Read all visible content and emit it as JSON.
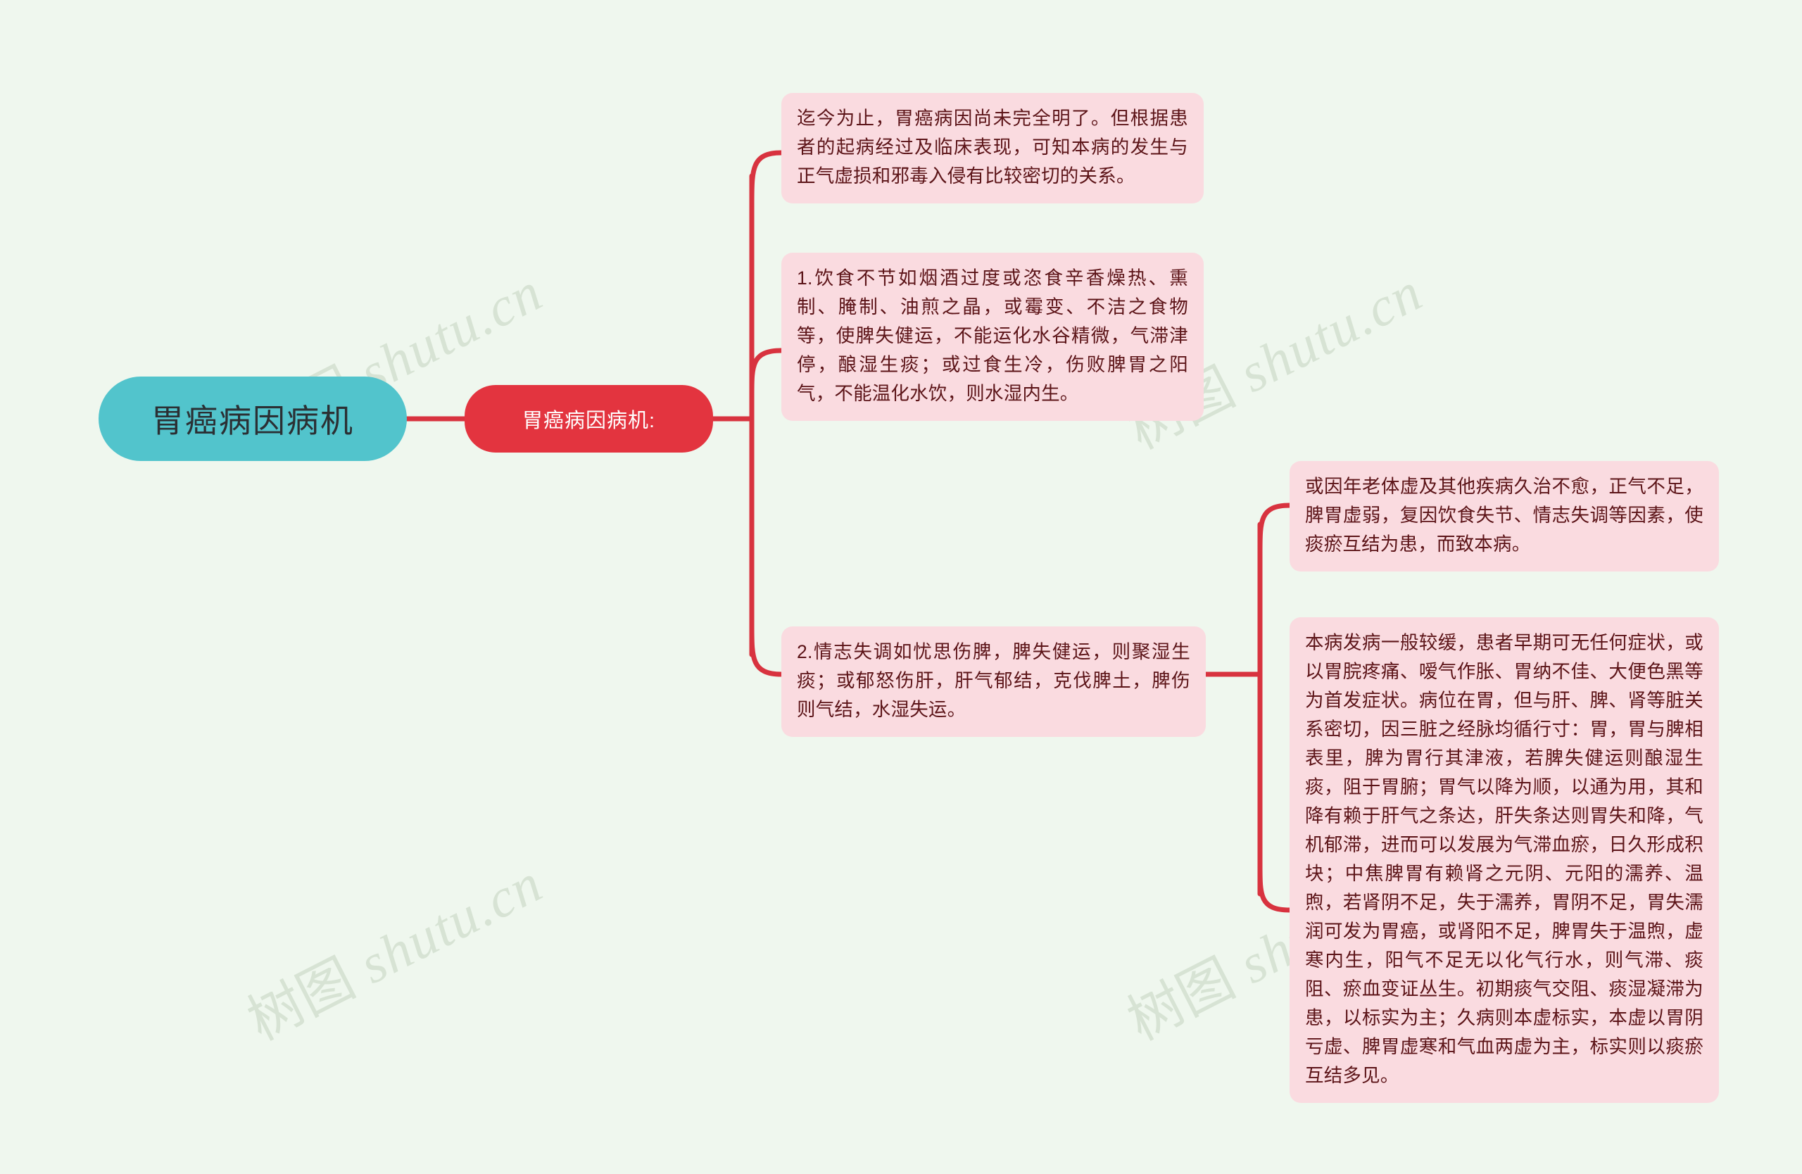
{
  "diagram": {
    "type": "mindmap",
    "orientation": "left-to-right",
    "background_color": "#eff7ee",
    "title": "胃癌病因病机"
  },
  "watermark": {
    "text": "树图 shutu.cn",
    "cjk": "树图",
    "latin": " shutu.cn",
    "color": "#d7e3d4"
  },
  "root": {
    "label": "胃癌病因病机",
    "fill": "#52c4cc",
    "text_color": "#2b3034"
  },
  "branch": {
    "label": "胃癌病因病机:",
    "fill": "#e3343f",
    "text_color": "#ffffff"
  },
  "link_color": "#d8333f",
  "leaf_fill": "#fadbe0",
  "leaf_text_color": "#5c1418",
  "leaves": {
    "etiology_overview": "迄今为止，胃癌病因尚未完全明了。但根据患者的起病经过及临床表现，可知本病的发生与正气虚损和邪毒入侵有比较密切的关系。",
    "cause_1_diet": "1.饮食不节如烟酒过度或恣食辛香燥热、熏制、腌制、油煎之晶，或霉变、不洁之食物等，使脾失健运，不能运化水谷精微，气滞津停，酿湿生痰；或过食生冷，伤败脾胃之阳气，不能温化水饮，则水湿内生。",
    "cause_2_emotion": "2.情志失调如忧思伤脾，脾失健运，则聚湿生痰；或郁怒伤肝，肝气郁结，克伐脾土，脾伤则气结，水湿失运。",
    "deficiency": "或因年老体虚及其他疾病久治不愈，正气不足，脾胃虚弱，复因饮食失节、情志失调等因素，使痰瘀互结为患，而致本病。",
    "pathogenesis": "本病发病一般较缓，患者早期可无任何症状，或以胃脘疼痛、嗳气作胀、胃纳不佳、大便色黑等为首发症状。病位在胃，但与肝、脾、肾等脏关系密切，因三脏之经脉均循行寸：胃，胃与脾相表里，脾为胃行其津液，若脾失健运则酿湿生痰，阻于胃腑；胃气以降为顺，以通为用，其和降有赖于肝气之条达，肝失条达则胃失和降，气机郁滞，进而可以发展为气滞血瘀，日久形成积块；中焦脾胃有赖肾之元阴、元阳的濡养、温煦，若肾阴不足，失于濡养，胃阴不足，胃失濡润可发为胃癌，或肾阳不足，脾胃失于温煦，虚寒内生，阳气不足无以化气行水，则气滞、痰阻、瘀血变证丛生。初期痰气交阻、痰湿凝滞为患，以标实为主；久病则本虚标实，本虚以胃阴亏虚、脾胃虚寒和气血两虚为主，标实则以痰瘀互结多见。"
  }
}
